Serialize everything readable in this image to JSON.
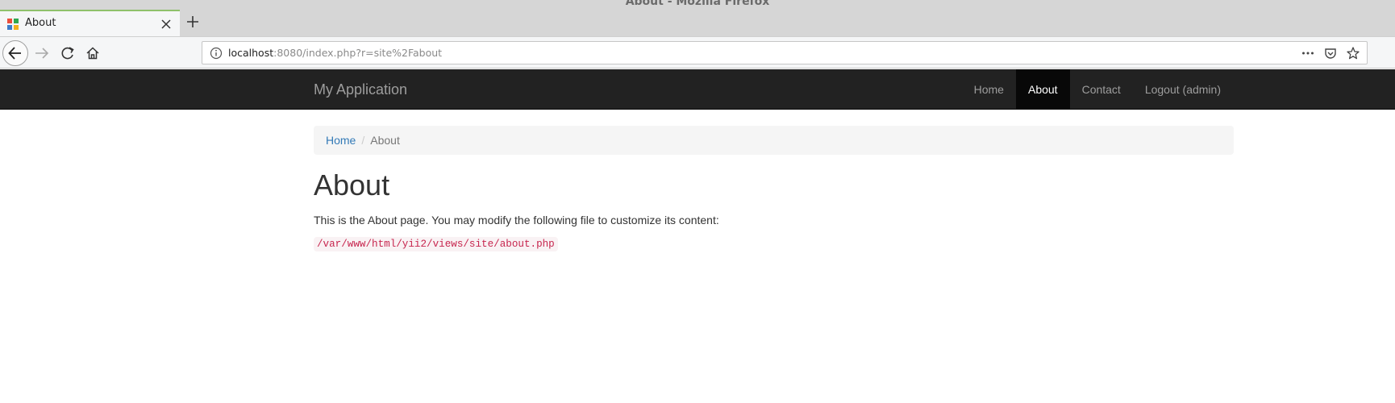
{
  "browser": {
    "window_title": "About - Mozilla Firefox",
    "tab": {
      "title": "About"
    },
    "url": {
      "host": "localhost",
      "rest": ":8080/index.php?r=site%2Fabout"
    },
    "icons": {
      "back": "back-arrow-icon",
      "forward": "forward-arrow-icon",
      "reload": "reload-icon",
      "home": "home-icon",
      "info": "info-icon",
      "more": "more-icon",
      "pocket": "pocket-icon",
      "bookmark": "star-icon",
      "close_tab": "close-icon",
      "new_tab": "plus-icon"
    }
  },
  "app": {
    "brand": "My Application",
    "nav": [
      {
        "label": "Home",
        "active": false
      },
      {
        "label": "About",
        "active": true
      },
      {
        "label": "Contact",
        "active": false
      },
      {
        "label": "Logout (admin)",
        "active": false
      }
    ],
    "breadcrumb": {
      "home": "Home",
      "separator": "/",
      "current": "About"
    },
    "page": {
      "title": "About",
      "intro": "This is the About page. You may modify the following file to customize its content:",
      "file_path": "/var/www/html/yii2/views/site/about.php"
    },
    "colors": {
      "navbar_bg": "#222222",
      "active_nav_bg": "#080808",
      "link": "#337ab7",
      "code": "#c7254e",
      "tab_accent": "#8fc16b"
    }
  }
}
